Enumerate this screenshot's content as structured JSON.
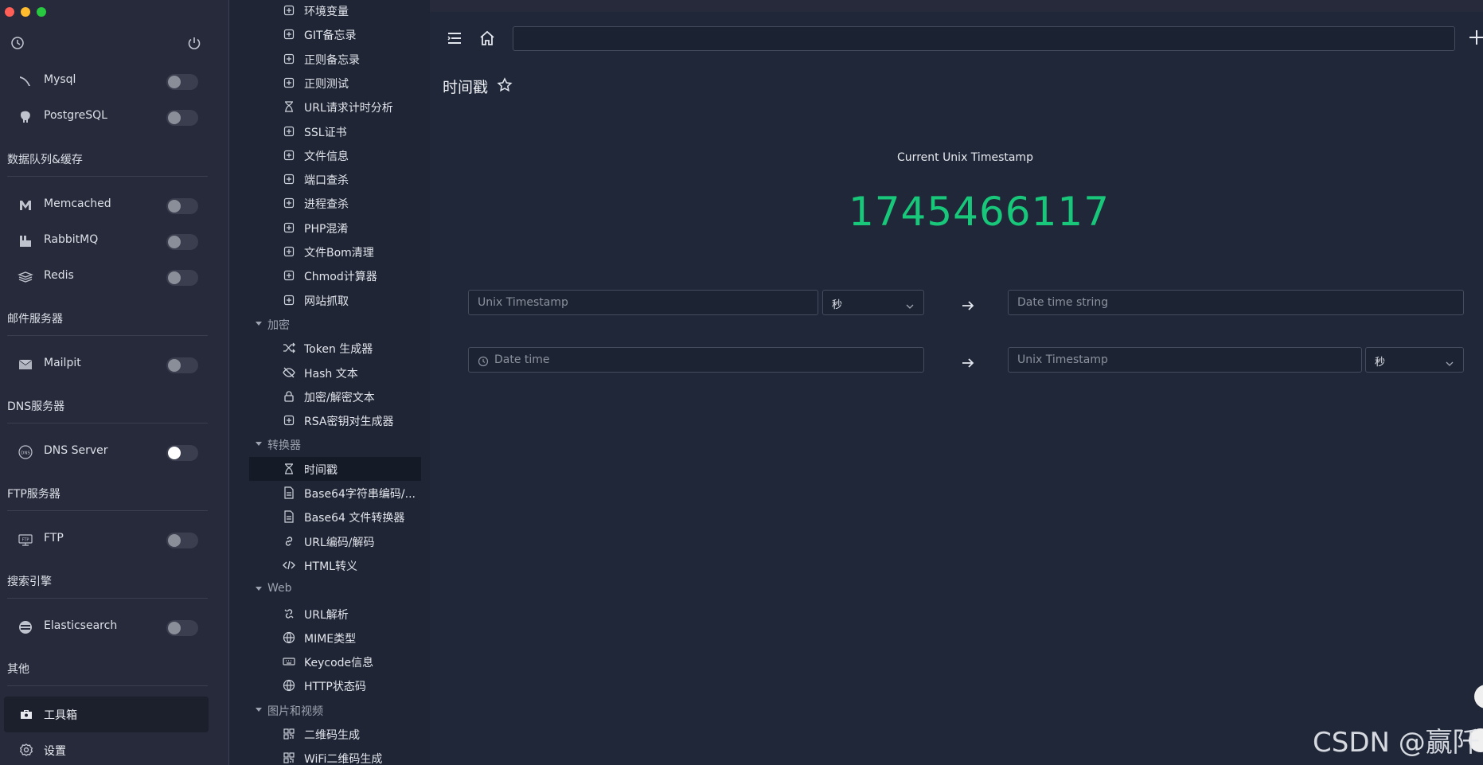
{
  "sidebar": {
    "services_top": [
      {
        "label": "Mysql",
        "icon": "dolphin-icon",
        "on": false
      },
      {
        "label": "PostgreSQL",
        "icon": "elephant-icon",
        "on": false
      }
    ],
    "groups": [
      {
        "title": "数据队列&缓存",
        "items": [
          {
            "label": "Memcached",
            "icon": "memcached-icon",
            "on": false
          },
          {
            "label": "RabbitMQ",
            "icon": "rabbitmq-icon",
            "on": false
          },
          {
            "label": "Redis",
            "icon": "redis-icon",
            "on": false
          }
        ]
      },
      {
        "title": "邮件服务器",
        "items": [
          {
            "label": "Mailpit",
            "icon": "mailpit-icon",
            "on": false
          }
        ]
      },
      {
        "title": "DNS服务器",
        "items": [
          {
            "label": "DNS Server",
            "icon": "dns-icon",
            "on": true
          }
        ]
      },
      {
        "title": "FTP服务器",
        "items": [
          {
            "label": "FTP",
            "icon": "ftp-icon",
            "on": false
          }
        ]
      },
      {
        "title": "搜索引擎",
        "items": [
          {
            "label": "Elasticsearch",
            "icon": "elasticsearch-icon",
            "on": false
          }
        ]
      },
      {
        "title": "其他",
        "items": []
      }
    ],
    "toolbox_label": "工具箱",
    "settings_label": "设置"
  },
  "tree": {
    "items": [
      {
        "type": "item",
        "label": "环境变量",
        "icon": "env-icon"
      },
      {
        "type": "item",
        "label": "GIT备忘录",
        "icon": "git-icon"
      },
      {
        "type": "item",
        "label": "正则备忘录",
        "icon": "regex-memo-icon"
      },
      {
        "type": "item",
        "label": "正则测试",
        "icon": "regex-test-icon"
      },
      {
        "type": "item",
        "label": "URL请求计时分析",
        "icon": "hourglass-icon"
      },
      {
        "type": "item",
        "label": "SSL证书",
        "icon": "ssl-icon"
      },
      {
        "type": "item",
        "label": "文件信息",
        "icon": "file-info-icon"
      },
      {
        "type": "item",
        "label": "端口查杀",
        "icon": "port-icon"
      },
      {
        "type": "item",
        "label": "进程查杀",
        "icon": "process-icon"
      },
      {
        "type": "item",
        "label": "PHP混淆",
        "icon": "php-icon"
      },
      {
        "type": "item",
        "label": "文件Bom清理",
        "icon": "bom-icon"
      },
      {
        "type": "item",
        "label": "Chmod计算器",
        "icon": "chmod-icon"
      },
      {
        "type": "item",
        "label": "网站抓取",
        "icon": "crawl-icon"
      },
      {
        "type": "cat",
        "label": "加密"
      },
      {
        "type": "item",
        "label": "Token 生成器",
        "icon": "shuffle-icon"
      },
      {
        "type": "item",
        "label": "Hash 文本",
        "icon": "eye-off-icon"
      },
      {
        "type": "item",
        "label": "加密/解密文本",
        "icon": "lock-icon"
      },
      {
        "type": "item",
        "label": "RSA密钥对生成器",
        "icon": "key-pair-icon"
      },
      {
        "type": "cat",
        "label": "转换器"
      },
      {
        "type": "item",
        "label": "时间戳",
        "icon": "hourglass-icon",
        "active": true
      },
      {
        "type": "item",
        "label": "Base64字符串编码/...",
        "icon": "file-text-icon"
      },
      {
        "type": "item",
        "label": "Base64 文件转换器",
        "icon": "file-text-icon"
      },
      {
        "type": "item",
        "label": "URL编码/解码",
        "icon": "link-icon"
      },
      {
        "type": "item",
        "label": "HTML转义",
        "icon": "code-icon"
      },
      {
        "type": "cat",
        "label": "Web"
      },
      {
        "type": "item",
        "label": "URL解析",
        "icon": "link-break-icon"
      },
      {
        "type": "item",
        "label": "MIME类型",
        "icon": "globe-icon"
      },
      {
        "type": "item",
        "label": "Keycode信息",
        "icon": "keyboard-icon"
      },
      {
        "type": "item",
        "label": "HTTP状态码",
        "icon": "globe-icon"
      },
      {
        "type": "cat",
        "label": "图片和视频"
      },
      {
        "type": "item",
        "label": "二维码生成",
        "icon": "qrcode-icon"
      },
      {
        "type": "item",
        "label": "WiFi二维码生成",
        "icon": "qrcode-icon"
      }
    ]
  },
  "main": {
    "search_value": "",
    "page_title": "时间戳",
    "timestamp_caption": "Current Unix Timestamp",
    "timestamp_value": "1745466117",
    "row1": {
      "input_placeholder": "Unix Timestamp",
      "unit": "秒",
      "output_placeholder": "Date time string"
    },
    "row2": {
      "input_placeholder": "Date time",
      "output_placeholder": "Unix Timestamp",
      "unit": "秒"
    }
  },
  "watermark": "CSDN @赢阡",
  "colors": {
    "accent_green": "#18c77a",
    "sidebar_bg": "#262a3b",
    "panel_bg": "#1f2535",
    "main_bg": "#1f2738"
  }
}
